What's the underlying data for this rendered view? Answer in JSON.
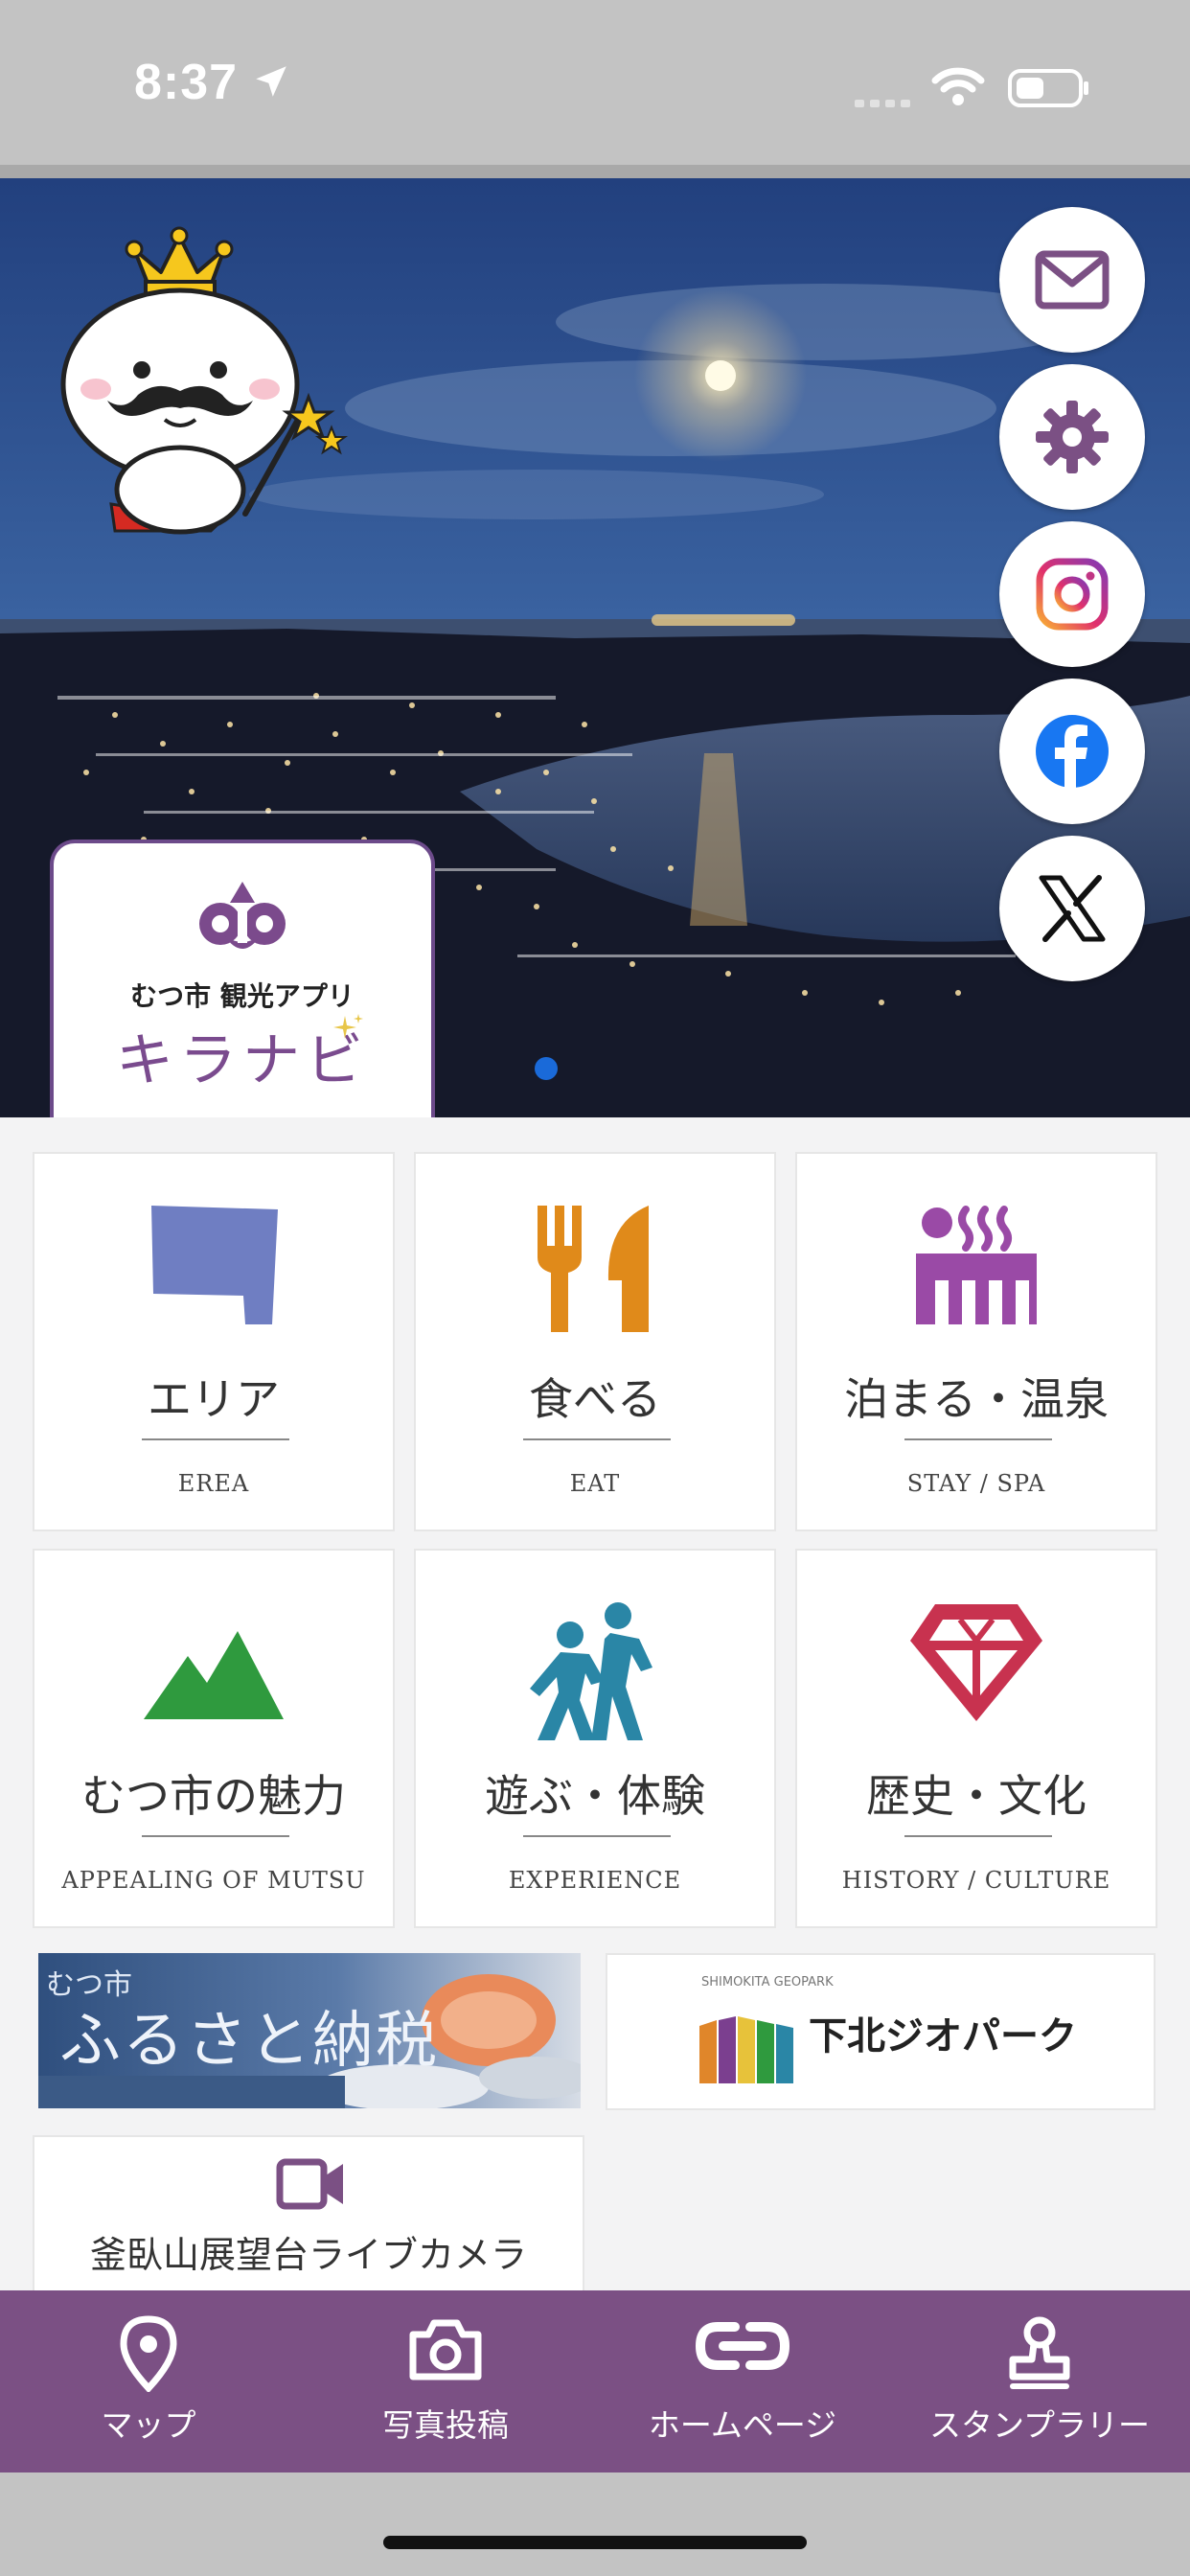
{
  "status_bar": {
    "time": "8:37"
  },
  "app": {
    "name": "キラナビ",
    "subtitle": "むつ市 観光アプリ"
  },
  "side_buttons": [
    {
      "name": "mail-button",
      "icon": "mail-icon"
    },
    {
      "name": "settings-button",
      "icon": "gear-icon"
    },
    {
      "name": "instagram-button",
      "icon": "instagram-icon"
    },
    {
      "name": "facebook-button",
      "icon": "facebook-icon"
    },
    {
      "name": "x-button",
      "icon": "x-icon"
    }
  ],
  "carousel": {
    "page_count": 1,
    "current": 1
  },
  "categories": [
    {
      "jp": "エリア",
      "en": "EREA",
      "icon": "area-map-icon",
      "color": "#6f7ec2"
    },
    {
      "jp": "食べる",
      "en": "EAT",
      "icon": "fork-knife-icon",
      "color": "#e08a1a"
    },
    {
      "jp": "泊まる・温泉",
      "en": "STAY / SPA",
      "icon": "hot-spring-icon",
      "color": "#9a4aa6"
    },
    {
      "jp": "むつ市の魅力",
      "en": "APPEALING OF MUTSU",
      "icon": "mountain-icon",
      "color": "#2f9a3e"
    },
    {
      "jp": "遊ぶ・体験",
      "en": "EXPERIENCE",
      "icon": "hikers-icon",
      "color": "#2a86a6"
    },
    {
      "jp": "歴史・文化",
      "en": "HISTORY / CULTURE",
      "icon": "diamond-icon",
      "color": "#c8324f"
    }
  ],
  "banners": {
    "furusato": {
      "small": "むつ市",
      "title": "ふるさと納税"
    },
    "geopark": {
      "small": "SHIMOKITA GEOPARK",
      "label": "下北ジオパーク"
    },
    "camera": {
      "label": "釜臥山展望台ライブカメラ",
      "icon": "video-camera-icon"
    }
  },
  "bottom_nav": [
    {
      "label": "マップ",
      "icon": "map-pin-icon"
    },
    {
      "label": "写真投稿",
      "icon": "camera-icon"
    },
    {
      "label": "ホームページ",
      "icon": "link-icon"
    },
    {
      "label": "スタンプラリー",
      "icon": "stamp-icon"
    }
  ],
  "colors": {
    "brand": "#7b5084",
    "carousel_dot": "#1a6ad9"
  }
}
